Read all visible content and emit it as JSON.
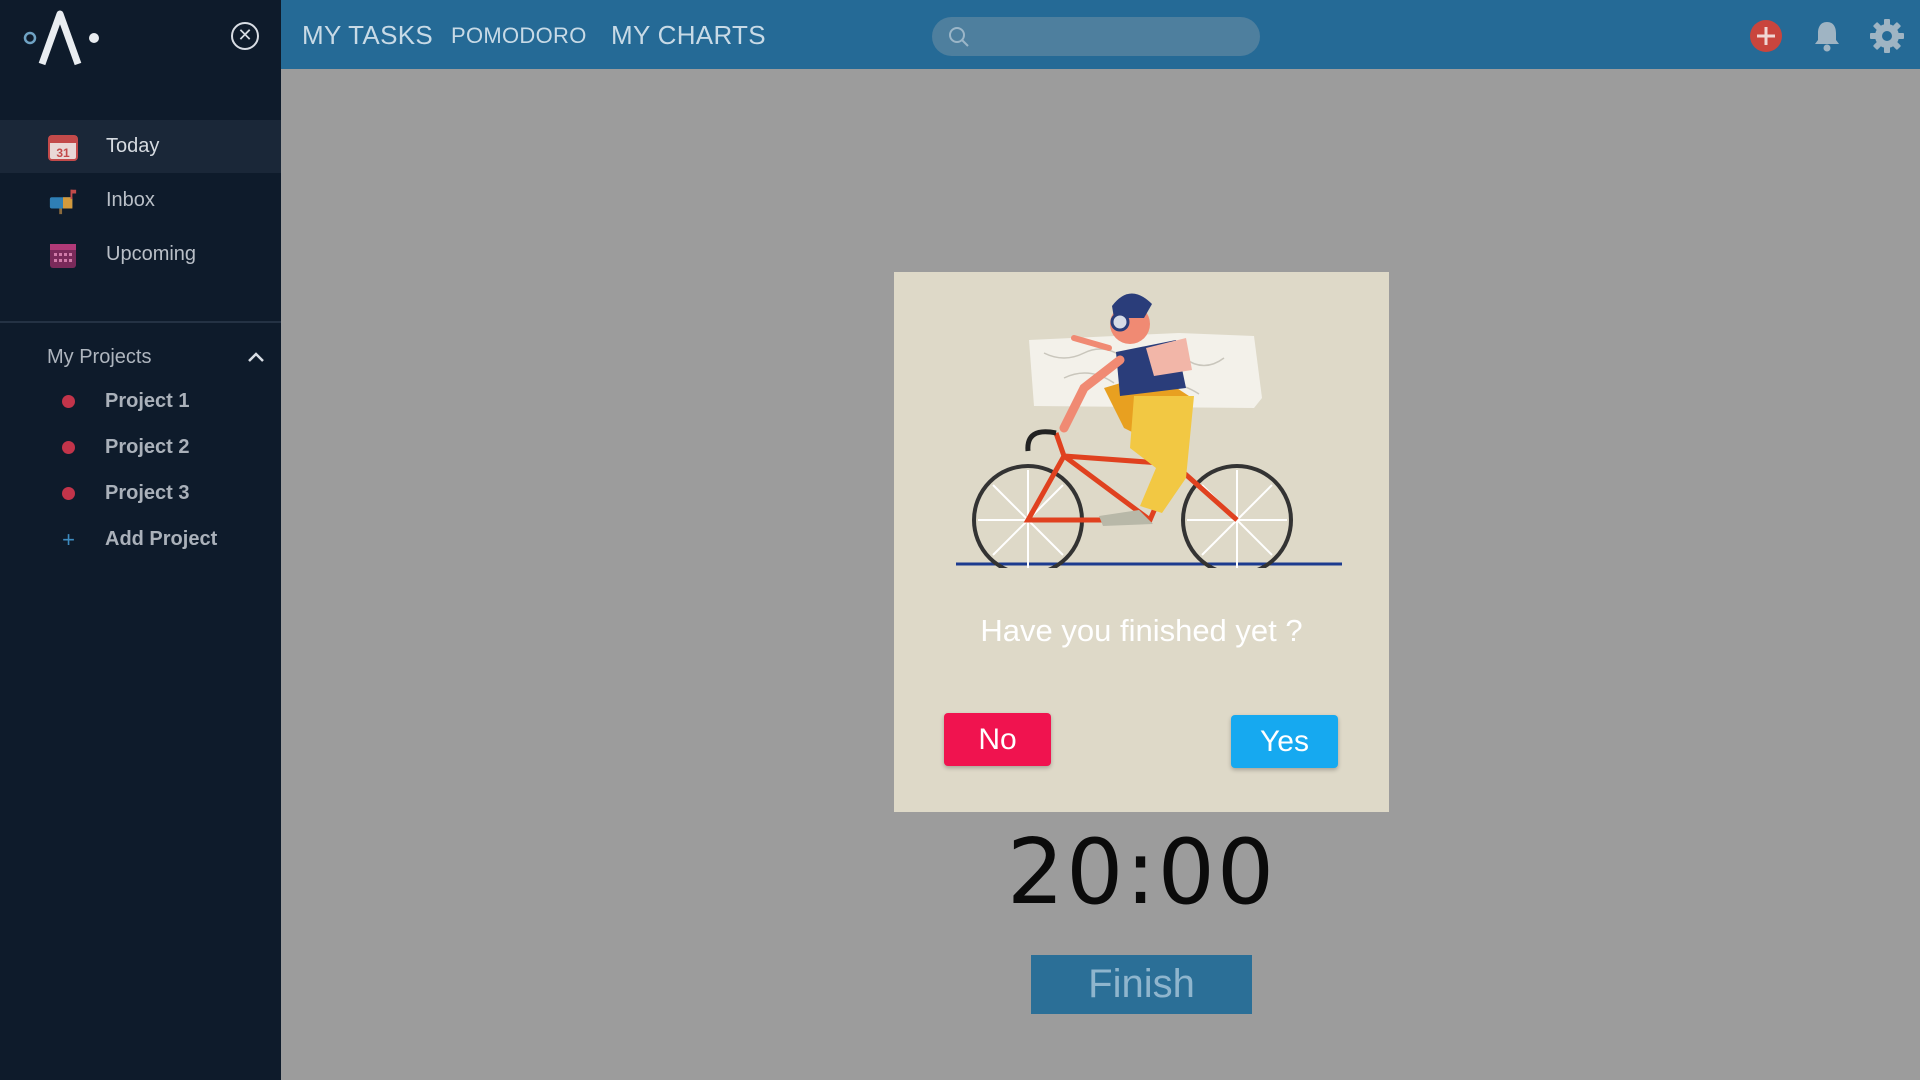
{
  "sidebar": {
    "nav": [
      {
        "label": "Today",
        "icon": "calendar-31-icon",
        "active": true
      },
      {
        "label": "Inbox",
        "icon": "mailbox-icon"
      },
      {
        "label": "Upcoming",
        "icon": "calendar-grid-icon"
      }
    ],
    "projects_title": "My Projects",
    "projects": [
      {
        "label": "Project 1"
      },
      {
        "label": "Project 2"
      },
      {
        "label": "Project 3"
      }
    ],
    "add_project_label": "Add Project",
    "calendar_day": "31"
  },
  "topbar": {
    "tabs": [
      {
        "label": "MY TASKS"
      },
      {
        "label": "POMODORO"
      },
      {
        "label": "MY CHARTS"
      }
    ],
    "search_placeholder": ""
  },
  "modal": {
    "question": "Have you finished yet ?",
    "no_label": "No",
    "yes_label": "Yes"
  },
  "timer": "20:00",
  "finish_label": "Finish",
  "colors": {
    "sidebar_bg": "#0e1b2b",
    "topbar_bg": "#256a96",
    "no_button": "#f0134f",
    "yes_button": "#16a9f0",
    "project_dot": "#c2344a"
  }
}
